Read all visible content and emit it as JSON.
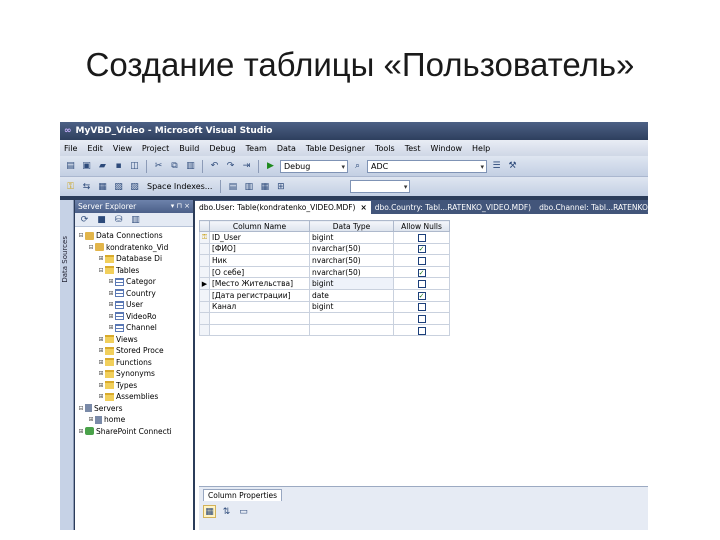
{
  "slide": {
    "title": "Создание таблицы «Пользователь»"
  },
  "window": {
    "title": "MyVBD_Video - Microsoft Visual Studio"
  },
  "menu": [
    "File",
    "Edit",
    "View",
    "Project",
    "Build",
    "Debug",
    "Team",
    "Data",
    "Table Designer",
    "Tools",
    "Test",
    "Window",
    "Help"
  ],
  "toolbar": {
    "config_value": "Debug",
    "solution_value": "ADC",
    "schema_label": "Space Indexes..."
  },
  "side_strip_label": "Data Sources",
  "explorer": {
    "title": "Server Explorer",
    "head_buttons": "▾ ⊓ ×",
    "items": [
      {
        "label": "Data Connections",
        "level": 0,
        "exp": "⊟",
        "icon": "db"
      },
      {
        "label": "kondratenko_Vid",
        "level": 1,
        "exp": "⊟",
        "icon": "db"
      },
      {
        "label": "Database Di",
        "level": 2,
        "exp": "⊞",
        "icon": "folder"
      },
      {
        "label": "Tables",
        "level": 2,
        "exp": "⊟",
        "icon": "folder"
      },
      {
        "label": "Categor",
        "level": 3,
        "exp": "⊞",
        "icon": "table"
      },
      {
        "label": "Country",
        "level": 3,
        "exp": "⊞",
        "icon": "table"
      },
      {
        "label": "User",
        "level": 3,
        "exp": "⊞",
        "icon": "table"
      },
      {
        "label": "VideoRo",
        "level": 3,
        "exp": "⊞",
        "icon": "table"
      },
      {
        "label": "Channel",
        "level": 3,
        "exp": "⊞",
        "icon": "table"
      },
      {
        "label": "Views",
        "level": 2,
        "exp": "⊞",
        "icon": "folder"
      },
      {
        "label": "Stored Proce",
        "level": 2,
        "exp": "⊞",
        "icon": "folder"
      },
      {
        "label": "Functions",
        "level": 2,
        "exp": "⊞",
        "icon": "folder"
      },
      {
        "label": "Synonyms",
        "level": 2,
        "exp": "⊞",
        "icon": "folder"
      },
      {
        "label": "Types",
        "level": 2,
        "exp": "⊞",
        "icon": "folder"
      },
      {
        "label": "Assemblies",
        "level": 2,
        "exp": "⊞",
        "icon": "folder"
      },
      {
        "label": "Servers",
        "level": 0,
        "exp": "⊟",
        "icon": "server"
      },
      {
        "label": "home",
        "level": 1,
        "exp": "⊞",
        "icon": "server"
      },
      {
        "label": "SharePoint Connecti",
        "level": 0,
        "exp": "⊞",
        "icon": "share"
      }
    ]
  },
  "tabs": [
    {
      "label": "dbo.User: Table(kondratenko_VIDEO.MDF)",
      "active": true,
      "close": "×"
    },
    {
      "label": "dbo.Country: Tabl...RATENKO_VIDEO.MDF)",
      "active": false
    },
    {
      "label": "dbo.Channel: Tabl...RATENKO_VIDEO.MDF)",
      "active": false
    }
  ],
  "grid": {
    "headers": [
      "",
      "Column Name",
      "Data Type",
      "Allow Nulls"
    ],
    "rows": [
      {
        "marker": "key",
        "name": "ID_User",
        "type": "bigint",
        "nulls": false
      },
      {
        "marker": "",
        "name": "[ФИО]",
        "type": "nvarchar(50)",
        "nulls": true
      },
      {
        "marker": "",
        "name": "Ник",
        "type": "nvarchar(50)",
        "nulls": false
      },
      {
        "marker": "",
        "name": "[О себе]",
        "type": "nvarchar(50)",
        "nulls": true
      },
      {
        "marker": "arrow",
        "name": "[Место Жительства]",
        "type": "bigint",
        "nulls": false
      },
      {
        "marker": "",
        "name": "[Дата регистрации]",
        "type": "date",
        "nulls": true
      },
      {
        "marker": "",
        "name": "Канал",
        "type": "bigint",
        "nulls": false
      },
      {
        "marker": "",
        "name": "",
        "type": "",
        "nulls": false
      },
      {
        "marker": "",
        "name": "",
        "type": "",
        "nulls": false
      }
    ]
  },
  "properties": {
    "tab_label": "Column Properties"
  },
  "icons": {
    "key": "key-icon",
    "arrow": "row-arrow-icon",
    "check": "checkmark-icon",
    "folder": "folder-icon",
    "table": "table-icon",
    "database": "database-icon"
  },
  "colors": {
    "title_bar": "#2e3f5e",
    "menu": "#dde3ee",
    "tab_strip": "#42557a"
  }
}
